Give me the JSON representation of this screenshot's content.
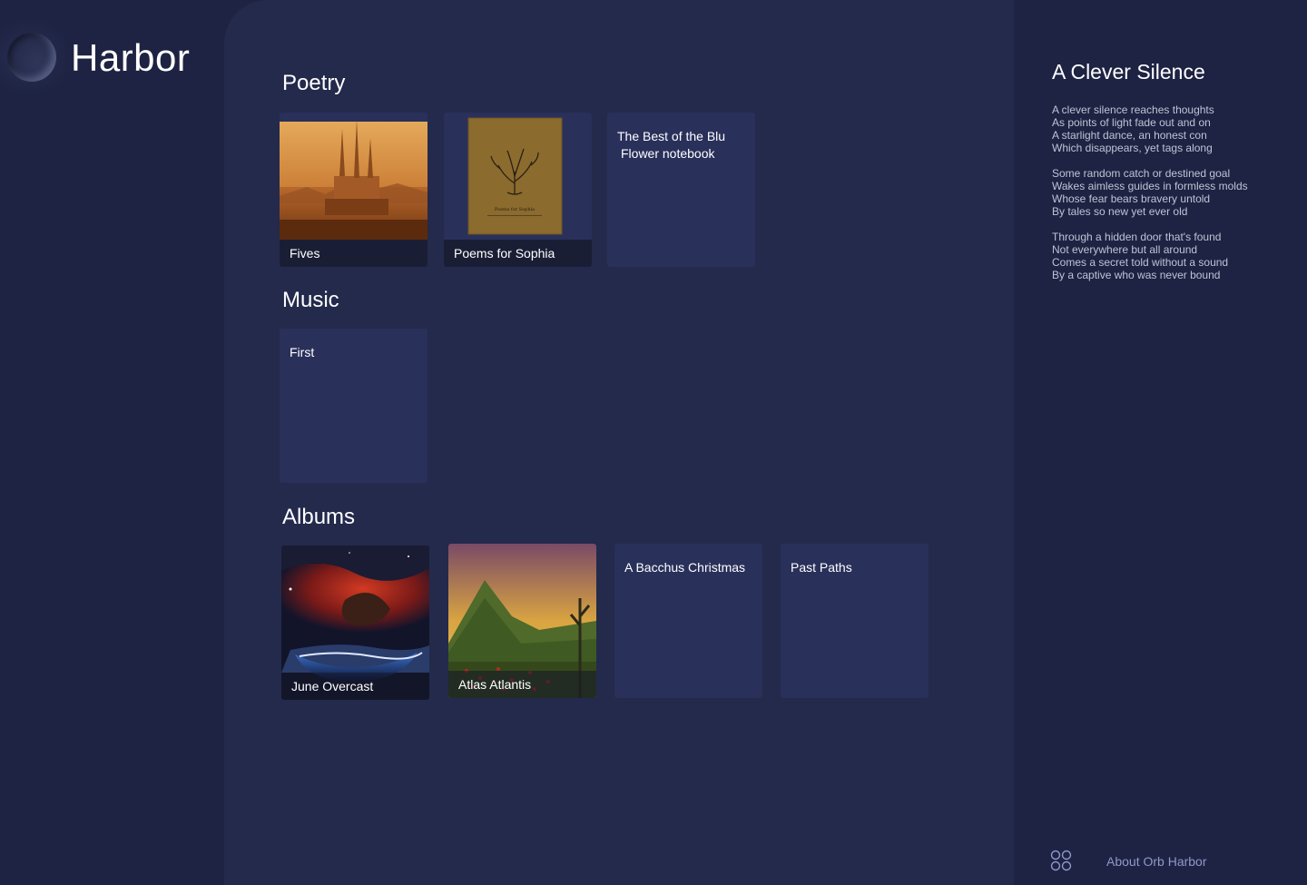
{
  "app": {
    "title": "Harbor"
  },
  "sections": {
    "poetry": {
      "title": "Poetry",
      "items": [
        {
          "label": "Fives"
        },
        {
          "label": "Poems for Sophia",
          "cover_text": "Poems for Sophia"
        },
        {
          "line1": "The Best of the Blu",
          "line2": "Flower notebook"
        }
      ]
    },
    "music": {
      "title": "Music",
      "items": [
        {
          "label": "First"
        }
      ]
    },
    "albums": {
      "title": "Albums",
      "items": [
        {
          "label": "June Overcast"
        },
        {
          "label": "Atlas Atlantis"
        },
        {
          "label": "A Bacchus Christmas"
        },
        {
          "label": "Past Paths"
        }
      ]
    }
  },
  "right_panel": {
    "title": "A Clever Silence",
    "stanzas": [
      [
        "A clever silence reaches thoughts",
        "As points of light fade out and on",
        "A starlight dance, an honest con",
        "Which disappears, yet tags along"
      ],
      [
        "Some random catch or destined goal",
        "Wakes aimless guides in formless molds",
        "Whose fear bears bravery untold",
        "By tales so new yet ever old"
      ],
      [
        "Through a hidden door that's found",
        "Not everywhere but all around",
        "Comes a secret told without a sound",
        "By a captive who was never bound"
      ]
    ],
    "footer": {
      "about_label": "About Orb Harbor",
      "icon": "grid-circles-icon"
    }
  },
  "colors": {
    "background": "#1e2343",
    "main_panel": "#232a4c",
    "tile": "#29305a",
    "link": "#8f98c8"
  }
}
